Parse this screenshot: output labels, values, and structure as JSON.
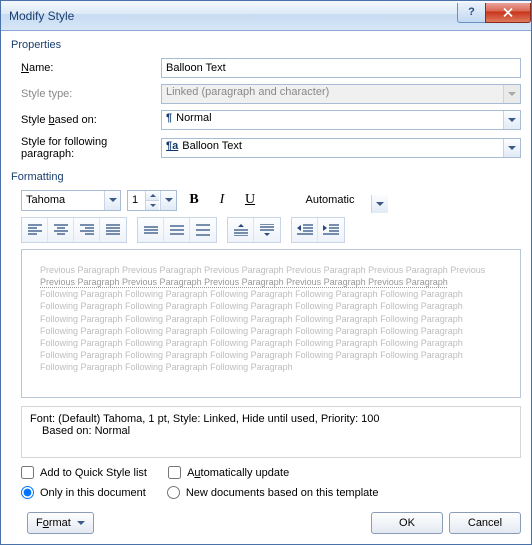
{
  "window": {
    "title": "Modify Style",
    "help_label": "?",
    "close_label": "X"
  },
  "properties": {
    "group_label": "Properties",
    "name_label_pre": "",
    "name_key": "N",
    "name_label_post": "ame:",
    "name_value": "Balloon Text",
    "type_label": "Style type:",
    "type_value": "Linked (paragraph and character)",
    "type_enabled": false,
    "based_pre": "Style ",
    "based_key": "b",
    "based_post": "ased on:",
    "based_icon": "¶",
    "based_value": "Normal",
    "following_label": "Style for following paragraph:",
    "following_icon": "¶a",
    "following_value": "Balloon Text"
  },
  "formatting": {
    "group_label": "Formatting",
    "font_name": "Tahoma",
    "font_size": "1",
    "bold_label": "B",
    "italic_label": "I",
    "underline_label": "U",
    "color_label": "Automatic"
  },
  "preview": {
    "prev_line": "Previous Paragraph Previous Paragraph Previous Paragraph Previous Paragraph Previous Paragraph Previous",
    "prev_line2": "Previous Paragraph Previous Paragraph Previous Paragraph Previous Paragraph Previous Paragraph",
    "follow_line": "Following Paragraph Following Paragraph Following Paragraph Following Paragraph Following Paragraph",
    "follow_line_short": "Following Paragraph Following Paragraph Following Paragraph"
  },
  "description": {
    "line1": "Font: (Default) Tahoma, 1 pt, Style: Linked, Hide until used, Priority: 100",
    "line2": "Based on: Normal"
  },
  "options": {
    "quick_style_label": "Add to Quick Style list",
    "quick_style_checked": false,
    "auto_update_pre": "A",
    "auto_update_key": "u",
    "auto_update_post": "tomatically update",
    "auto_update_checked": false,
    "only_doc_label": "Only in this document",
    "only_doc_selected": true,
    "new_docs_label": "New documents based on this template",
    "new_docs_selected": false
  },
  "footer": {
    "format_pre": "F",
    "format_key": "o",
    "format_post": "rmat",
    "ok_label": "OK",
    "cancel_label": "Cancel"
  }
}
